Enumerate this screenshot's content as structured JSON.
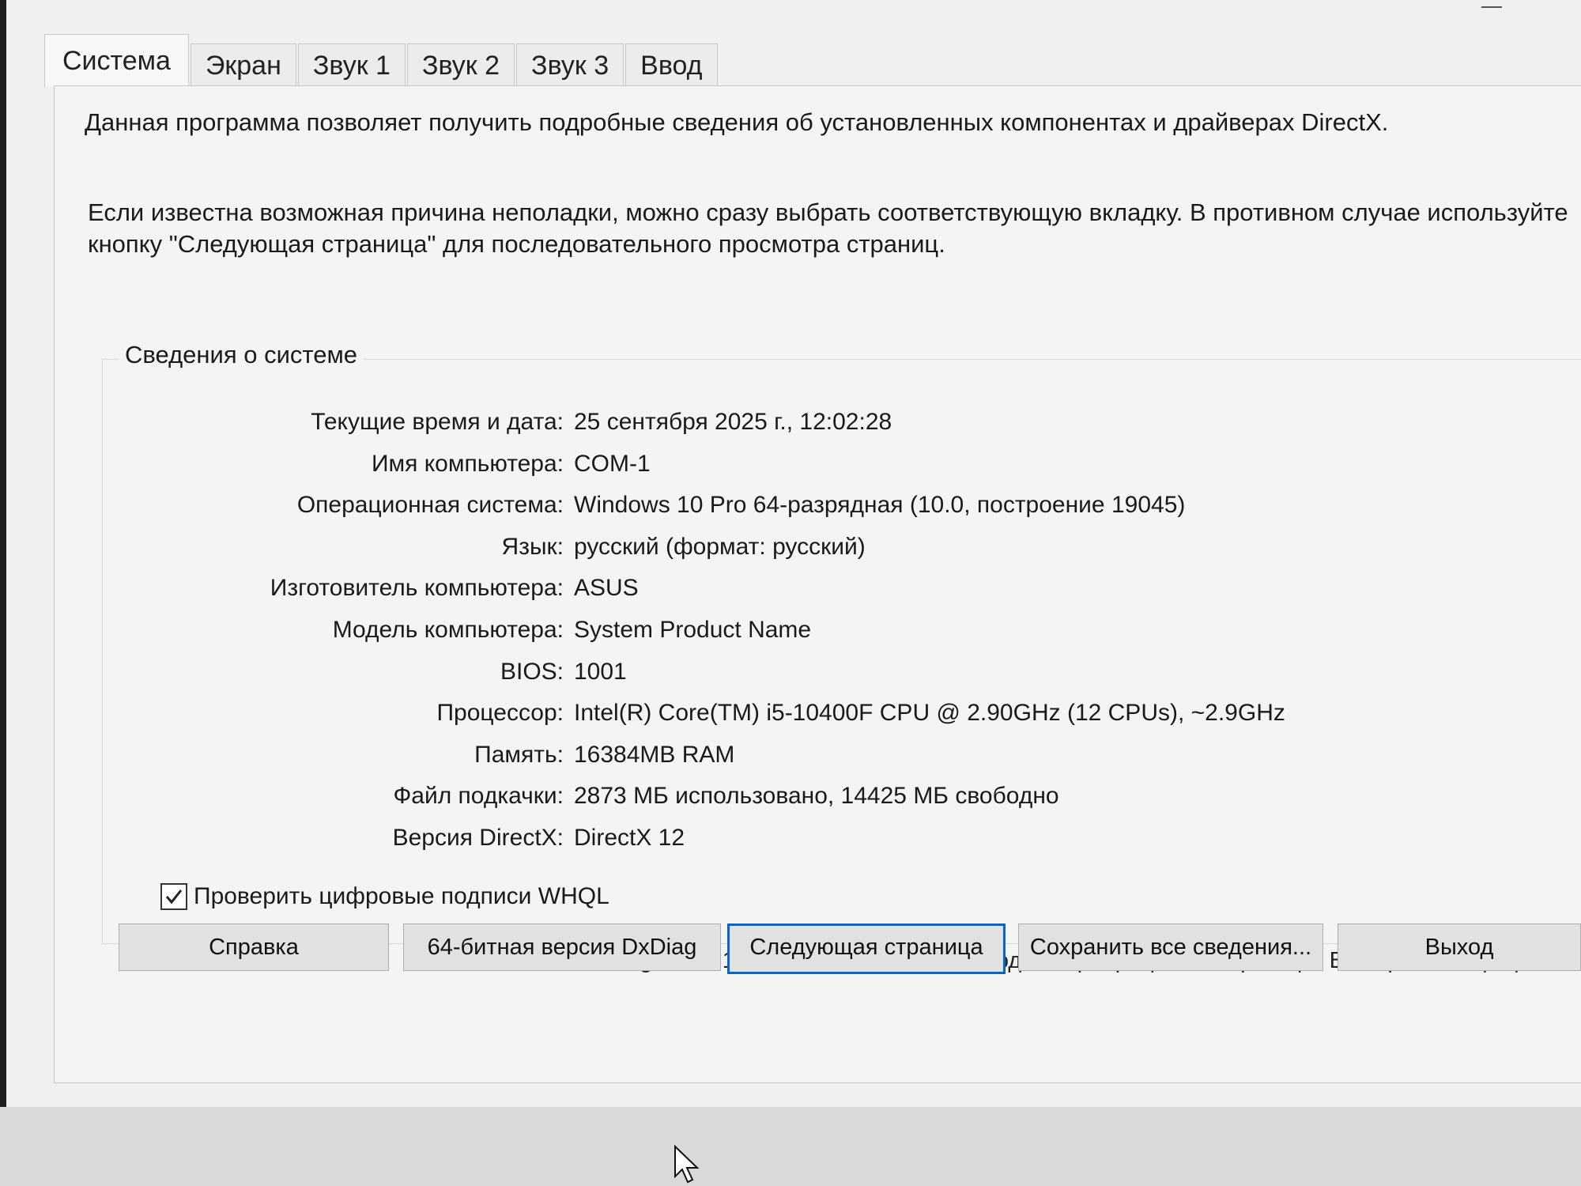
{
  "tabs": [
    "Система",
    "Экран",
    "Звук 1",
    "Звук 2",
    "Звук 3",
    "Ввод"
  ],
  "active_tab": "Система",
  "intro_text": "Данная программа позволяет получить подробные сведения об установленных компонентах и драйверах DirectX.",
  "hint_text": "Если известна возможная причина неполадки, можно сразу выбрать соответствующую вкладку. В противном случае используйте кнопку \"Следующая страница\" для последовательного просмотра страниц.",
  "system_info": {
    "title": "Сведения о системе",
    "rows": [
      {
        "label": "Текущие время и дата:",
        "value": "25 сентября 2025 г., 12:02:28"
      },
      {
        "label": "Имя компьютера:",
        "value": "COM-1"
      },
      {
        "label": "Операционная система:",
        "value": "Windows 10 Pro 64-разрядная (10.0, построение 19045)"
      },
      {
        "label": "Язык:",
        "value": "русский (формат: русский)"
      },
      {
        "label": "Изготовитель компьютера:",
        "value": "ASUS"
      },
      {
        "label": "Модель компьютера:",
        "value": "System Product Name"
      },
      {
        "label": "BIOS:",
        "value": "1001"
      },
      {
        "label": "Процессор:",
        "value": "Intel(R) Core(TM) i5-10400F CPU @ 2.90GHz (12 CPUs), ~2.9GHz"
      },
      {
        "label": "Память:",
        "value": "16384MB RAM"
      },
      {
        "label": "Файл подкачки:",
        "value": "2873 МБ использовано, 14425 МБ свободно"
      },
      {
        "label": "Версия DirectX:",
        "value": "DirectX 12"
      }
    ]
  },
  "whql_checkbox": {
    "label": "Проверить цифровые подписи WHQL",
    "checked": true
  },
  "copyright": "DxDiag 10.00.19041.3636 32 бита Юникод © Корпорация Майкрософт. Все права защищены.",
  "buttons": {
    "help": "Справка",
    "dxdiag64": "64-битная версия DxDiag",
    "next_page": "Следующая страница",
    "save_all": "Сохранить все сведения...",
    "exit": "Выход"
  },
  "icons": {
    "checkmark": "checkmark-icon",
    "cursor": "mouse-cursor-icon"
  }
}
